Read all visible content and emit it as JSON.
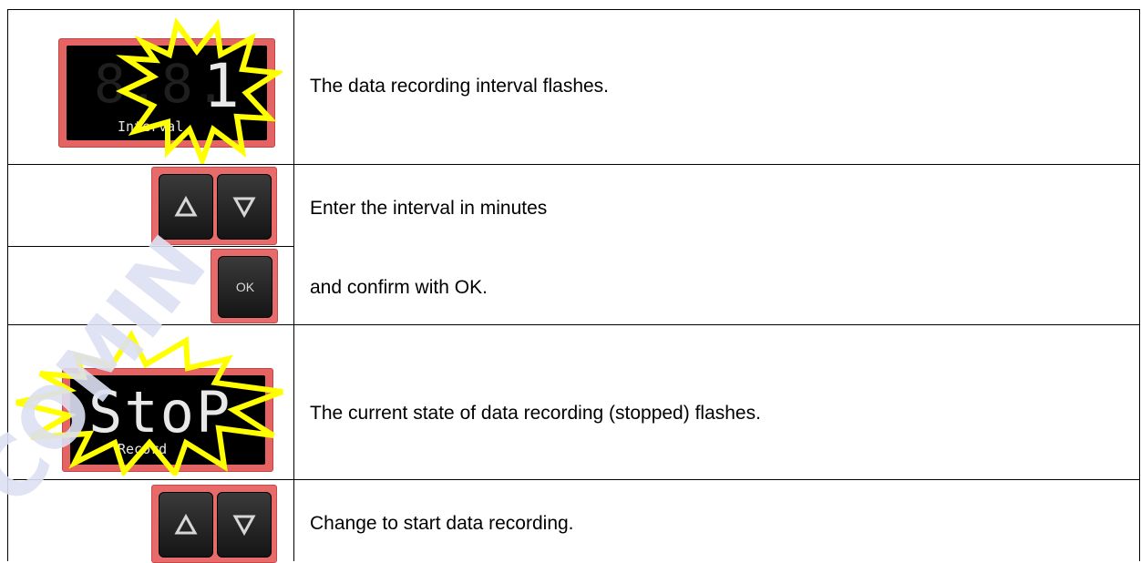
{
  "rows": [
    {
      "text": "The data recording interval flashes.",
      "display": {
        "value": "1",
        "label": "Interval"
      }
    },
    {
      "text": "Enter the interval in minutes",
      "buttons": [
        "up-arrow-icon",
        "down-arrow-icon"
      ]
    },
    {
      "text": "and confirm with OK.",
      "button_label": "OK"
    },
    {
      "text": "The current state of data recording (stopped) flashes.",
      "display": {
        "value": "StoP",
        "label": "Record"
      }
    },
    {
      "text": "Change to start data recording.",
      "buttons": [
        "up-arrow-icon",
        "down-arrow-icon"
      ]
    }
  ],
  "colors": {
    "panel_red": "#e46464",
    "burst_yellow": "#ffff00",
    "button_dark": "#1e1e1e",
    "watermark": "#d9dcf0"
  }
}
